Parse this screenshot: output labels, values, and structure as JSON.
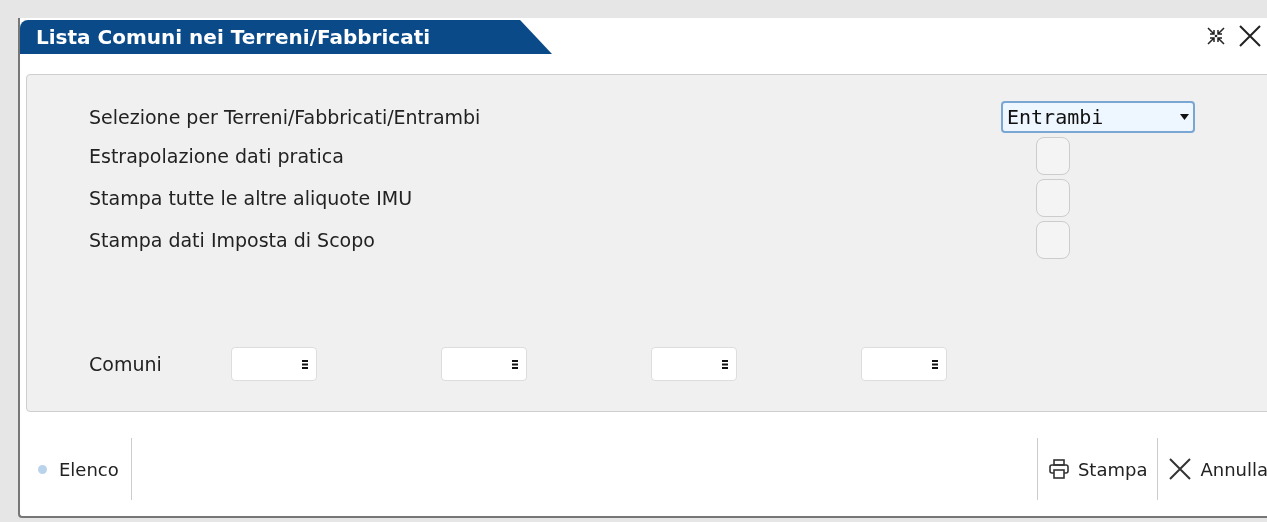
{
  "window": {
    "title": "Lista Comuni nei Terreni/Fabbricati"
  },
  "options": [
    {
      "kind": "select",
      "label": "Selezione per Terreni/Fabbricati/Entrambi",
      "value": "Entrambi"
    },
    {
      "kind": "checkbox",
      "label": "Estrapolazione dati pratica",
      "checked": false
    },
    {
      "kind": "checkbox",
      "label": "Stampa tutte le altre aliquote IMU",
      "checked": false
    },
    {
      "kind": "checkbox",
      "label": "Stampa dati Imposta di Scopo",
      "checked": false
    }
  ],
  "comuni": {
    "label": "Comuni",
    "fields": [
      {
        "kind": "lookup"
      },
      {
        "kind": "lookup"
      },
      {
        "kind": "lookup"
      },
      {
        "kind": "lookup"
      }
    ]
  },
  "footer": {
    "left": [
      {
        "label": "Elenco"
      }
    ],
    "buttons": [
      {
        "kind": "print",
        "label": "Stampa"
      },
      {
        "kind": "cancel",
        "label": "Annulla"
      }
    ]
  }
}
